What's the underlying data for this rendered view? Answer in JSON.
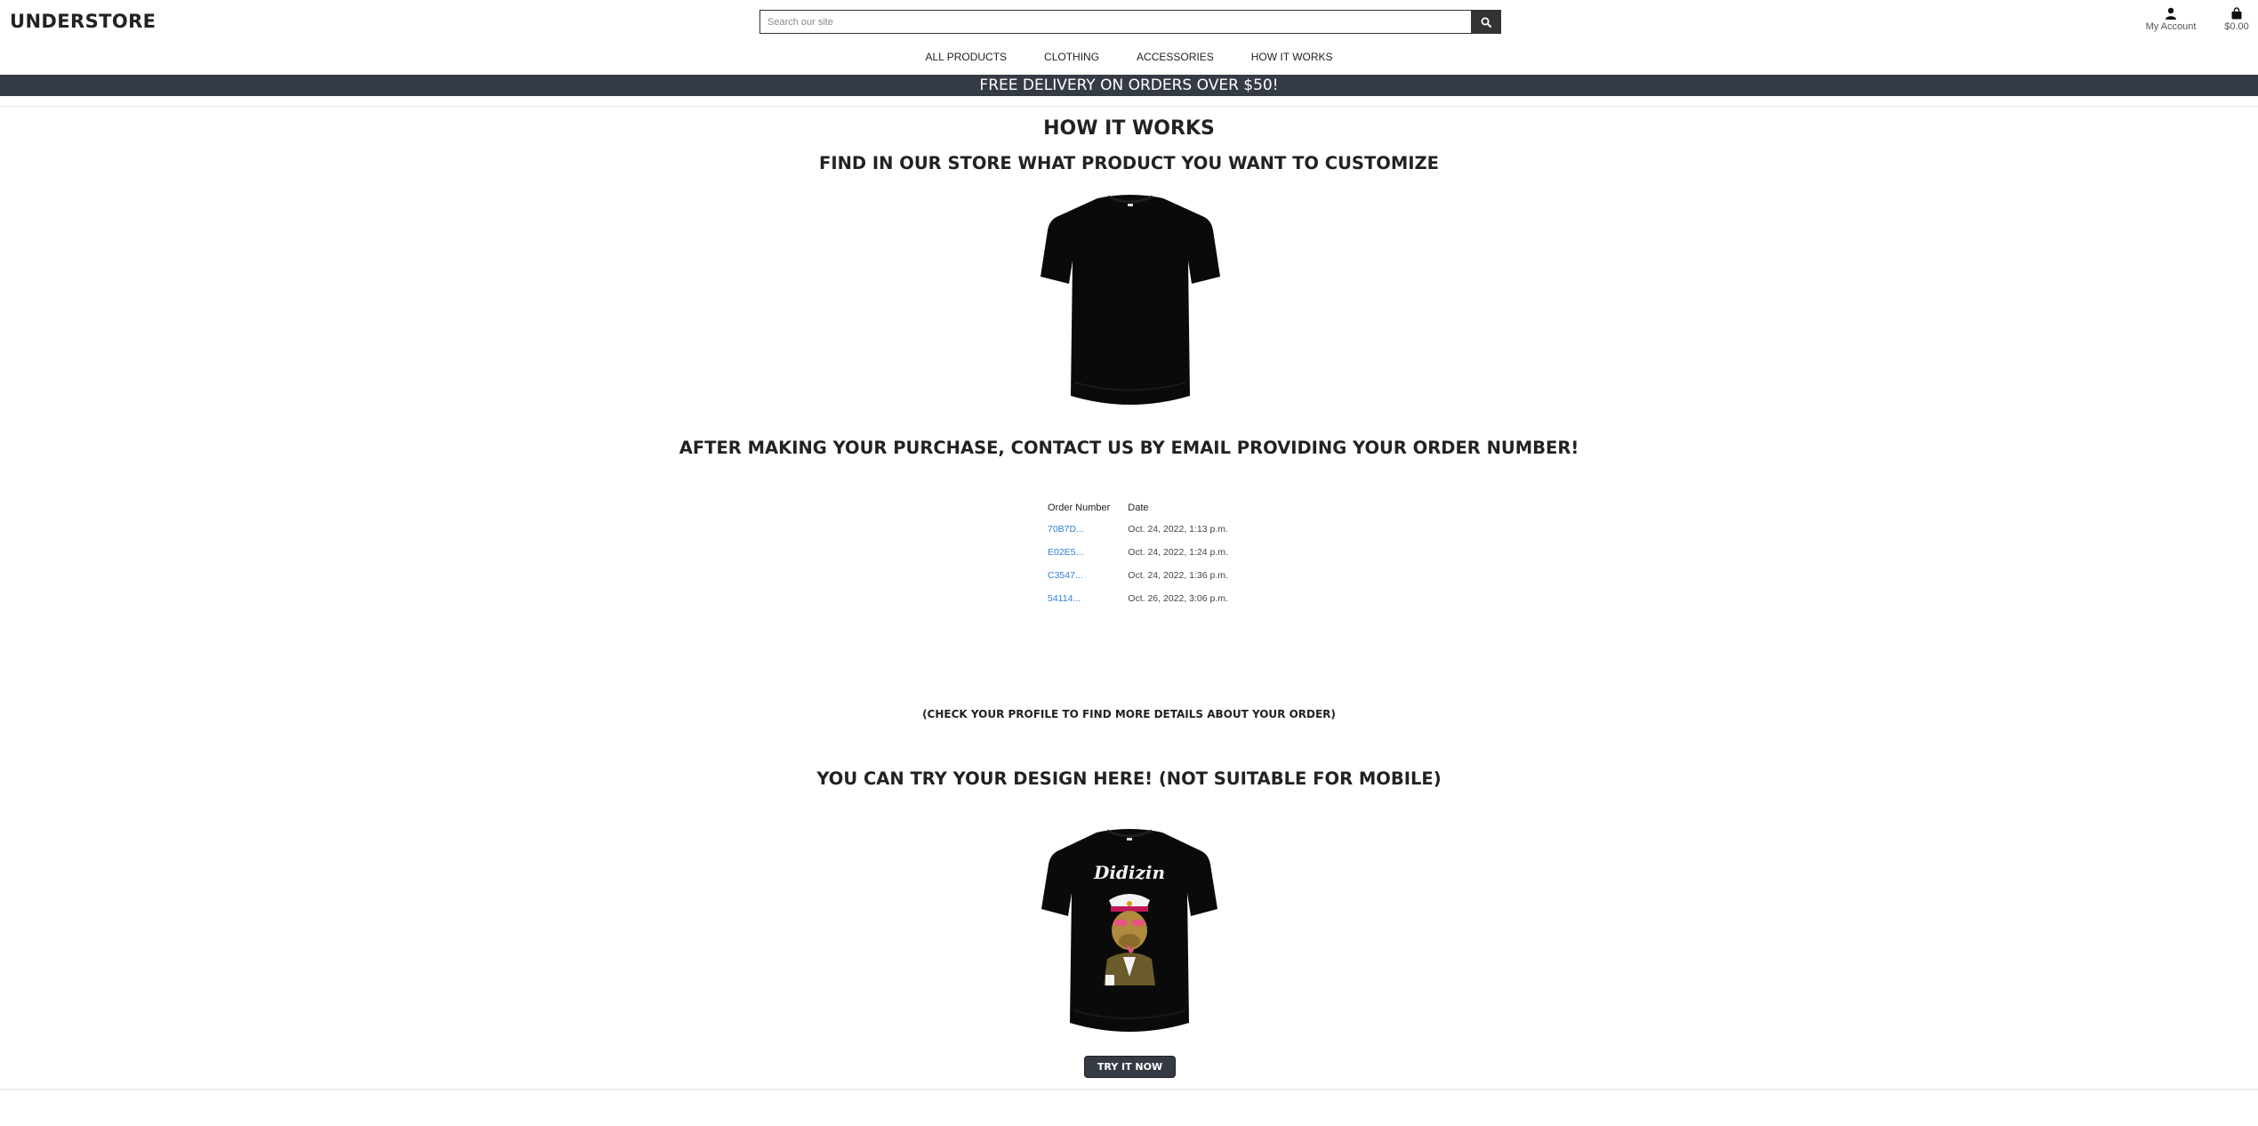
{
  "header": {
    "logo": "UNDERSTORE",
    "search_placeholder": "Search our site",
    "account_label": "My Account",
    "cart_total": "$0.00"
  },
  "nav": {
    "items": [
      {
        "label": "ALL PRODUCTS"
      },
      {
        "label": "CLOTHING"
      },
      {
        "label": "ACCESSORIES"
      },
      {
        "label": "HOW IT WORKS"
      }
    ]
  },
  "banner": "FREE DELIVERY ON ORDERS OVER $50!",
  "main": {
    "title": "HOW IT WORKS",
    "step1": "FIND IN OUR STORE WHAT PRODUCT YOU WANT TO CUSTOMIZE",
    "step2": "AFTER MAKING YOUR PURCHASE, CONTACT US BY EMAIL PROVIDING YOUR ORDER NUMBER!",
    "orders_table": {
      "headers": [
        "Order Number",
        "Date"
      ],
      "rows": [
        {
          "order": "70B7D...",
          "date": "Oct. 24, 2022, 1:13 p.m."
        },
        {
          "order": "E02E5...",
          "date": "Oct. 24, 2022, 1:24 p.m."
        },
        {
          "order": "C3547...",
          "date": "Oct. 24, 2022, 1:36 p.m."
        },
        {
          "order": "54114...",
          "date": "Oct. 26, 2022, 3:06 p.m."
        }
      ]
    },
    "profile_note": "(CHECK YOUR PROFILE TO FIND MORE DETAILS ABOUT YOUR ORDER)",
    "step3": "YOU CAN TRY YOUR DESIGN HERE! (NOT SUITABLE FOR MOBILE)",
    "design_text": "Didizin",
    "try_button": "TRY IT NOW"
  },
  "colors": {
    "banner_bg": "#353b44",
    "link": "#2f7fd6",
    "button_bg": "#353b44"
  },
  "icons": {
    "search": "search-icon",
    "account": "user-icon",
    "cart": "bag-icon"
  }
}
